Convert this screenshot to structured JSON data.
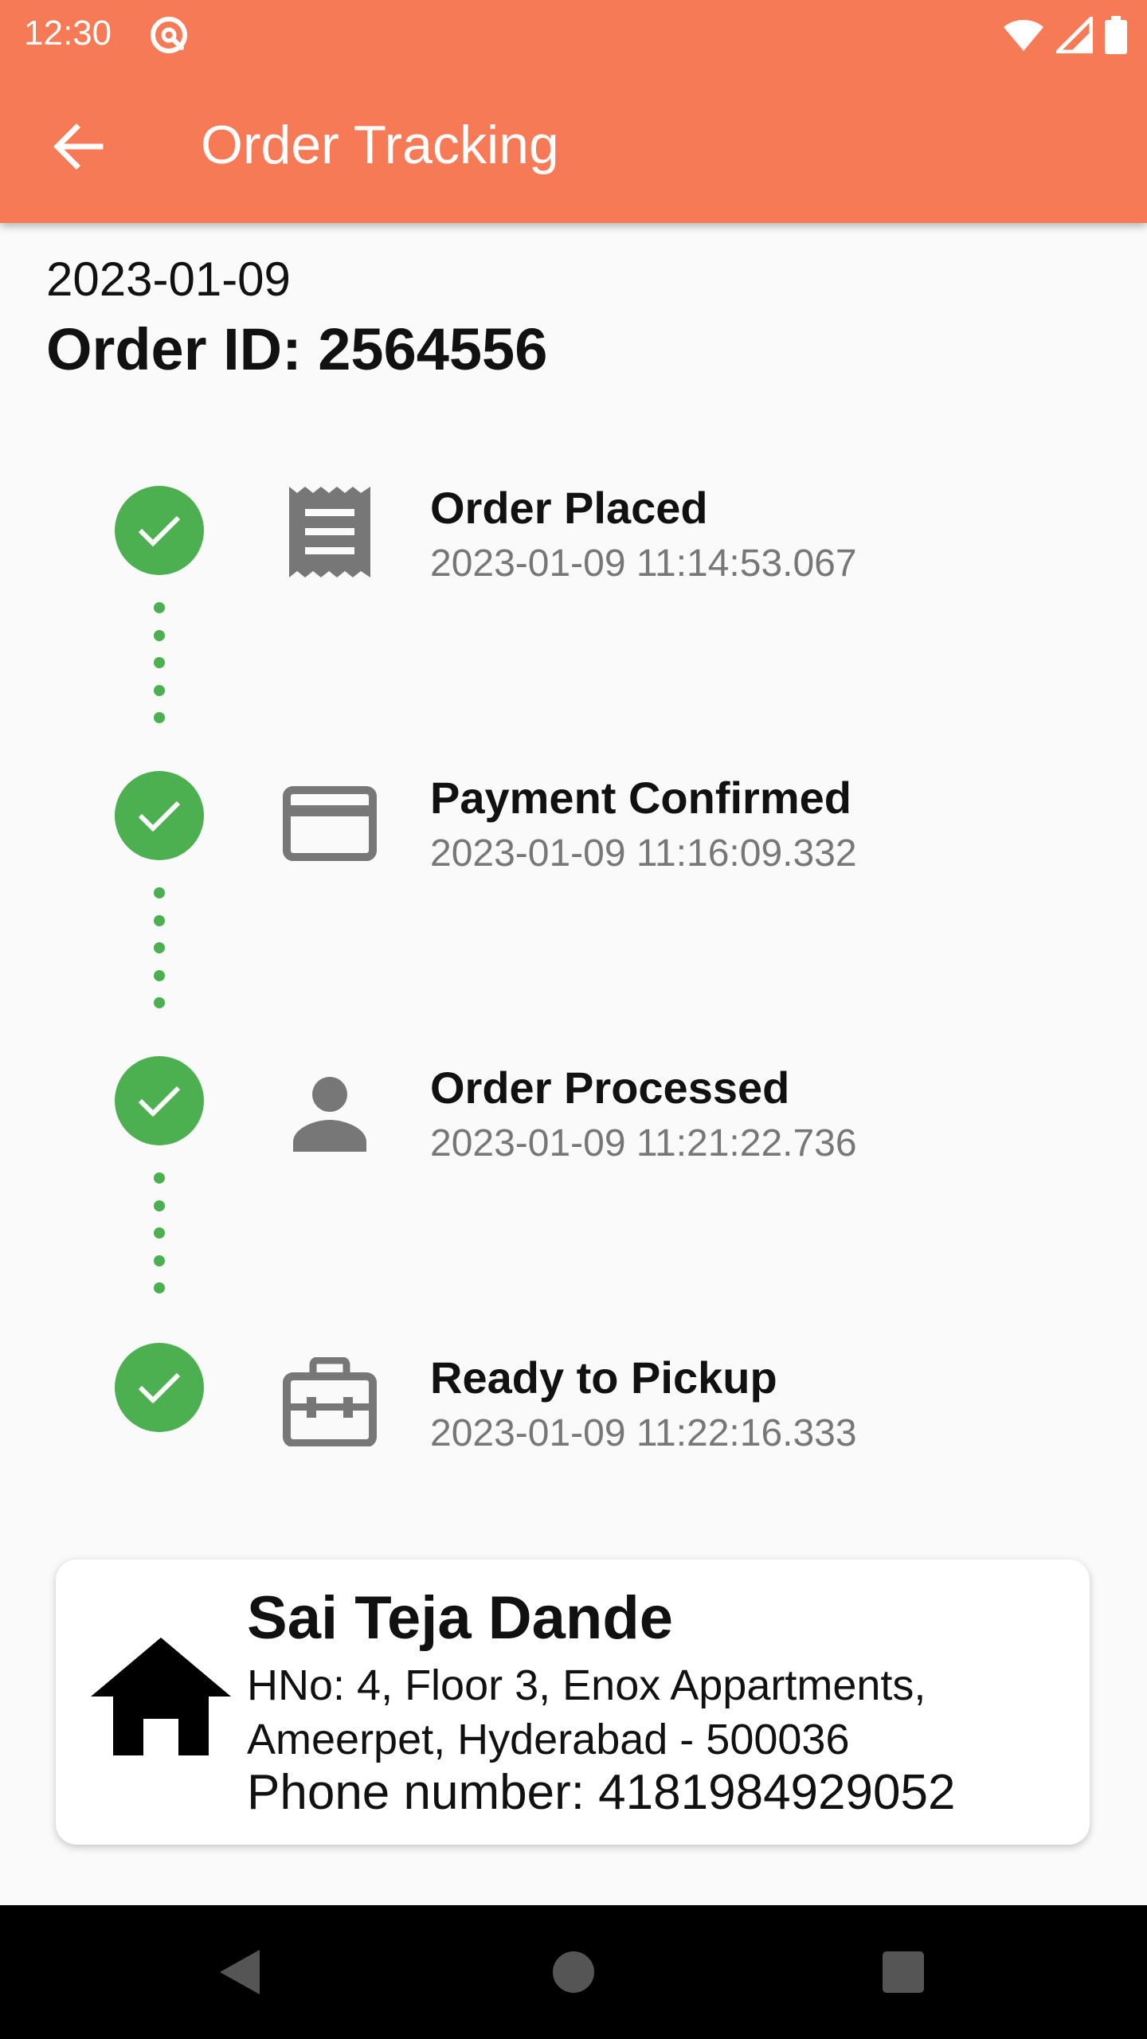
{
  "status_bar": {
    "time": "12:30",
    "icons": [
      "notification-app-icon",
      "wifi-icon",
      "signal-icon",
      "battery-icon"
    ]
  },
  "app_bar": {
    "title": "Order Tracking",
    "back_icon": "arrow-back-icon",
    "background_color": "#f77a56"
  },
  "order": {
    "date": "2023-01-09",
    "id_label": "Order ID: 2564556"
  },
  "timeline": {
    "accent_color": "#4caf50",
    "steps": [
      {
        "title": "Order Placed",
        "time": "2023-01-09 11:14:53.067",
        "icon": "receipt-icon",
        "status_icon": "check-icon"
      },
      {
        "title": "Payment Confirmed",
        "time": "2023-01-09 11:16:09.332",
        "icon": "credit-card-icon",
        "status_icon": "check-icon"
      },
      {
        "title": "Order Processed",
        "time": "2023-01-09 11:21:22.736",
        "icon": "person-icon",
        "status_icon": "check-icon"
      },
      {
        "title": "Ready to Pickup",
        "time": "2023-01-09 11:22:16.333",
        "icon": "briefcase-icon",
        "status_icon": "check-icon"
      }
    ]
  },
  "address": {
    "icon": "home-icon",
    "name": "Sai Teja Dande",
    "line1": "HNo: 4, Floor 3, Enox Appartments,",
    "line2": "Ameerpet, Hyderabad - 500036",
    "phone": "Phone number: 4181984929052"
  },
  "nav_bar": {
    "buttons": [
      "back-triangle-icon",
      "home-circle-icon",
      "recents-square-icon"
    ]
  }
}
